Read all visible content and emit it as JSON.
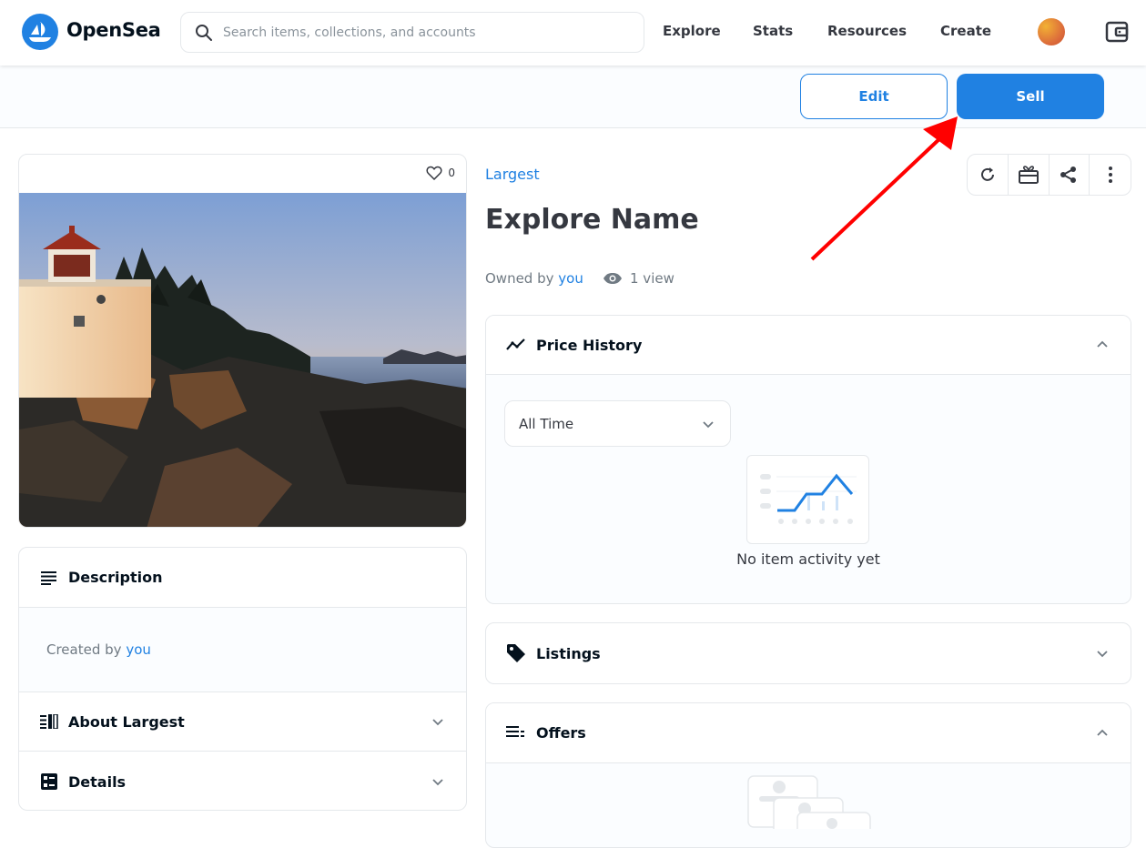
{
  "nav": {
    "logo": "OpenSea",
    "search_placeholder": "Search items, collections, and accounts",
    "links": [
      "Explore",
      "Stats",
      "Resources",
      "Create"
    ]
  },
  "toolbar": {
    "edit_label": "Edit",
    "sell_label": "Sell"
  },
  "image_card": {
    "favorites_count": "0"
  },
  "description": {
    "title": "Description",
    "created_prefix": "Created by",
    "creator": "you"
  },
  "about": {
    "title": "About Largest"
  },
  "details": {
    "title": "Details"
  },
  "item": {
    "collection": "Largest",
    "name": "Explore Name",
    "owned_prefix": "Owned by",
    "owner": "you",
    "views": "1 view"
  },
  "price_history": {
    "title": "Price History",
    "range": "All Time",
    "empty": "No item activity yet"
  },
  "listings": {
    "title": "Listings"
  },
  "offers": {
    "title": "Offers"
  },
  "colors": {
    "accent": "#2081e2",
    "border": "#e5e8eb",
    "annotation": "#ff0000"
  }
}
